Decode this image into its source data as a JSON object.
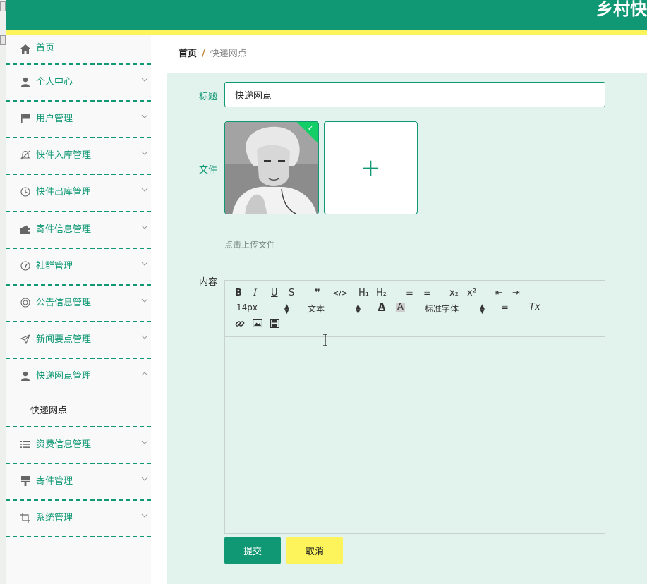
{
  "header": {
    "title": "乡村快"
  },
  "sidebar": {
    "items": [
      {
        "label": "首页",
        "icon": "home-icon",
        "expandable": false
      },
      {
        "label": "个人中心",
        "icon": "user-icon",
        "expandable": true
      },
      {
        "label": "用户管理",
        "icon": "flag-icon",
        "expandable": true
      },
      {
        "label": "快件入库管理",
        "icon": "bell-off-icon",
        "expandable": true
      },
      {
        "label": "快件出库管理",
        "icon": "clock-icon",
        "expandable": true
      },
      {
        "label": "寄件信息管理",
        "icon": "wallet-icon",
        "expandable": true
      },
      {
        "label": "社群管理",
        "icon": "gauge-icon",
        "expandable": true
      },
      {
        "label": "公告信息管理",
        "icon": "lifebuoy-icon",
        "expandable": true
      },
      {
        "label": "新闻要点管理",
        "icon": "send-icon",
        "expandable": true
      },
      {
        "label": "快递网点管理",
        "icon": "user-icon",
        "expandable": true,
        "expanded": true,
        "children": [
          {
            "label": "快递网点"
          }
        ]
      },
      {
        "label": "资费信息管理",
        "icon": "list-icon",
        "expandable": true
      },
      {
        "label": "寄件管理",
        "icon": "brush-icon",
        "expandable": true
      },
      {
        "label": "系统管理",
        "icon": "crop-icon",
        "expandable": true
      }
    ]
  },
  "breadcrumb": {
    "home": "首页",
    "separator": "/",
    "current": "快递网点"
  },
  "form": {
    "title_label": "标题",
    "title_value": "快递网点",
    "file_label": "文件",
    "upload_tip": "点击上传文件",
    "content_label": "内容",
    "uploader_plus": "+",
    "submit_label": "提交",
    "cancel_label": "取消"
  },
  "editor": {
    "font_size": "14px",
    "header_select": "文本",
    "font_family": "标准字体",
    "buttons": {
      "bold": "B",
      "italic": "I",
      "underline": "U",
      "strike": "S",
      "quote": "❞",
      "code": "</>",
      "h1": "H₁",
      "h2": "H₂",
      "ordered_list": "≡",
      "bullet_list": "≡",
      "subscript": "x₂",
      "superscript": "x²",
      "indent_decrease": "⇤",
      "indent_increase": "⇥",
      "font_color": "A",
      "background": "A",
      "align": "≡",
      "clean": "Tx"
    }
  },
  "colors": {
    "brand": "#0f9873",
    "accent_yellow": "#fdf35a",
    "content_bg": "#e2f2ec"
  }
}
